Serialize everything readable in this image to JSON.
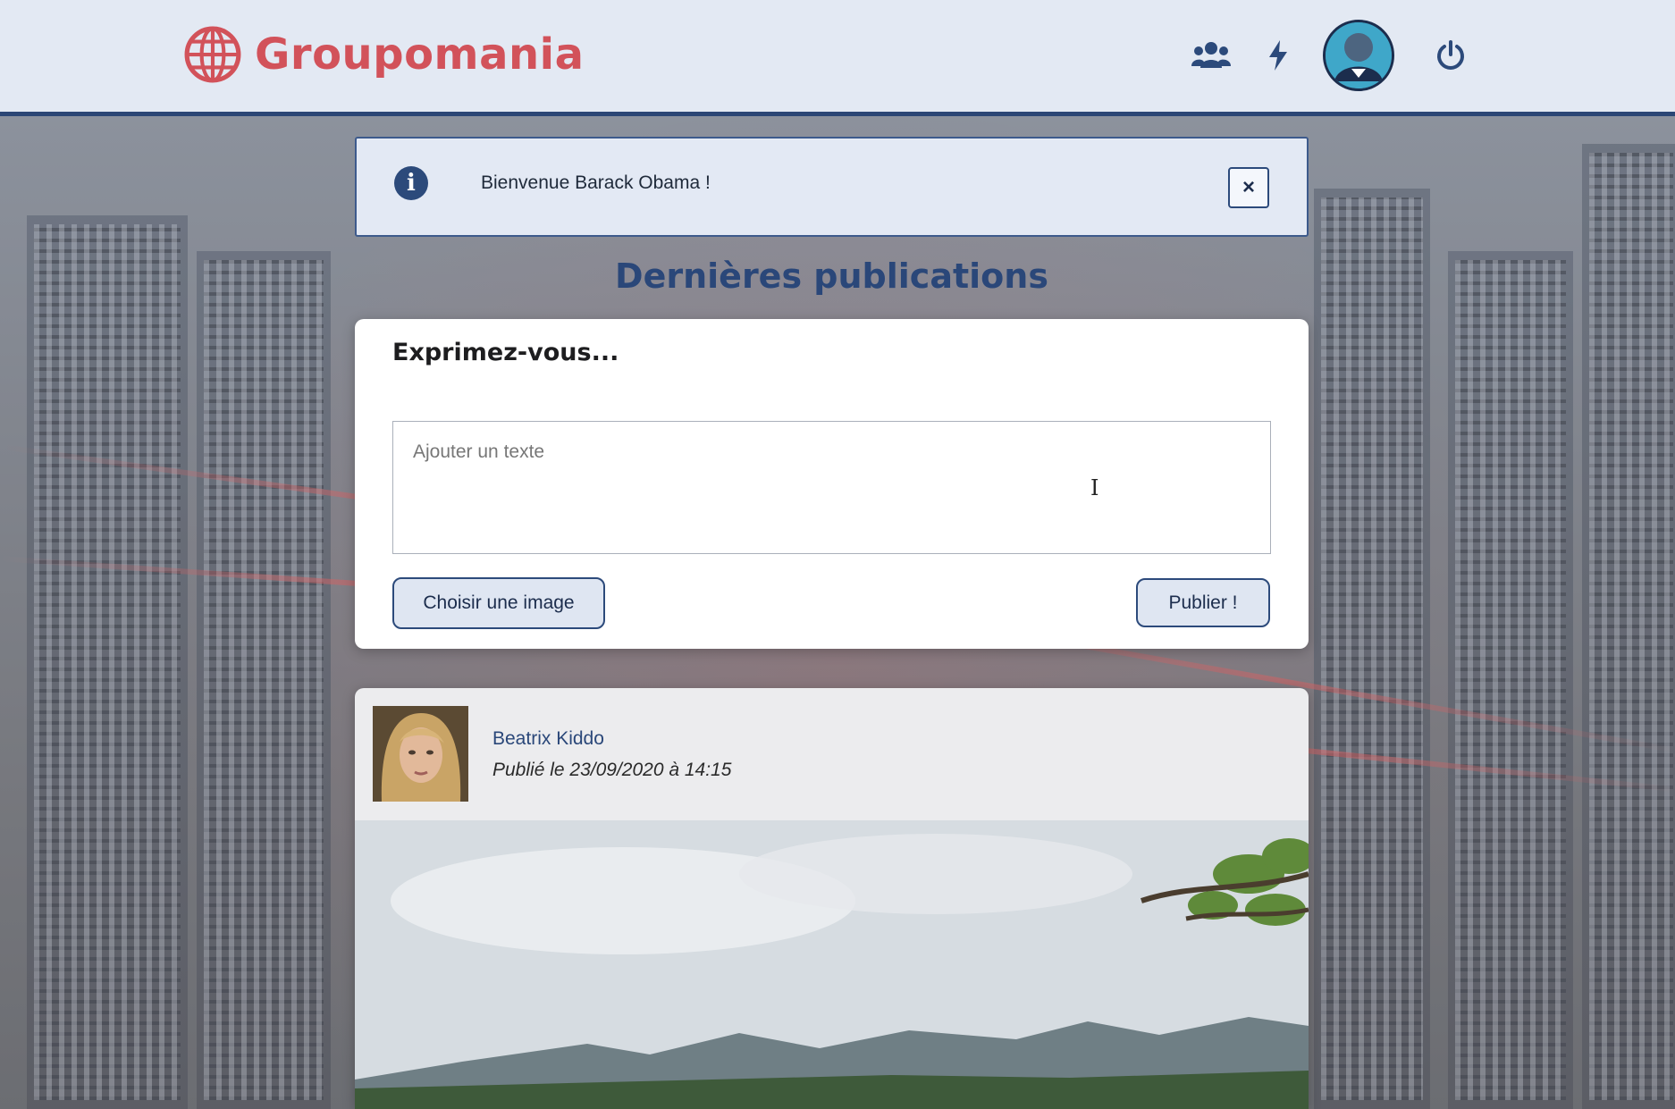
{
  "app": {
    "brand": "Groupomania"
  },
  "nav": {
    "items": [
      {
        "icon": "users-icon"
      },
      {
        "icon": "bolt-icon"
      },
      {
        "icon": "profile-avatar"
      },
      {
        "icon": "power-icon"
      }
    ]
  },
  "alert": {
    "message": "Bienvenue Barack Obama !",
    "close_label": "×"
  },
  "feed": {
    "title": "Dernières publications"
  },
  "compose": {
    "heading": "Exprimez-vous...",
    "placeholder": "Ajouter un texte",
    "image_button": "Choisir une image",
    "publish_button": "Publier !"
  },
  "post": {
    "author": "Beatrix Kiddo",
    "published": "Publié le 23/09/2020 à 14:15"
  },
  "colors": {
    "brand": "#d2525a",
    "primary": "#2a4779",
    "header_bg": "#e3e9f3"
  }
}
